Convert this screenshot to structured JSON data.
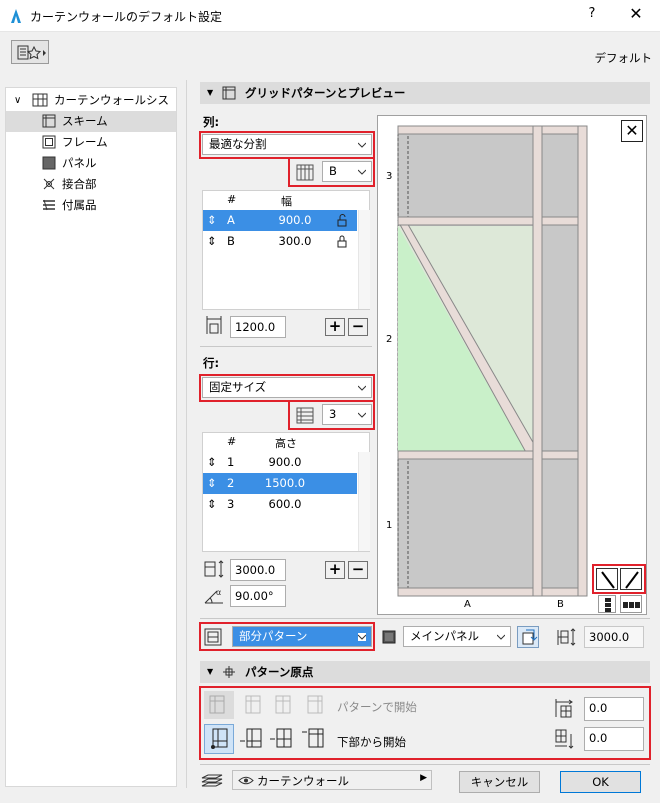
{
  "window": {
    "title": "カーテンウォールのデフォルト設定",
    "help": "?",
    "close": "✕"
  },
  "header": {
    "default_label": "デフォルト"
  },
  "tree": {
    "root": "カーテンウォールシステム",
    "items": [
      {
        "label": "スキーム",
        "selected": true
      },
      {
        "label": "フレーム",
        "selected": false
      },
      {
        "label": "パネル",
        "selected": false
      },
      {
        "label": "接合部",
        "selected": false
      },
      {
        "label": "付属品",
        "selected": false
      }
    ]
  },
  "grid_section": {
    "title": "グリッドパターンとプレビュー",
    "columns": {
      "label": "列:",
      "mode": "最適な分割",
      "pattern_select": "B",
      "headers": [
        "#",
        "幅"
      ],
      "rows": [
        {
          "sort": "⇕",
          "id": "A",
          "value": "900.0",
          "lock": "unlocked",
          "selected": true
        },
        {
          "sort": "⇕",
          "id": "B",
          "value": "300.0",
          "lock": "locked",
          "selected": false
        }
      ],
      "total": "1200.0"
    },
    "rows_part": {
      "label": "行:",
      "mode": "固定サイズ",
      "pattern_select": "3",
      "headers": [
        "#",
        "高さ"
      ],
      "rows": [
        {
          "sort": "⇕",
          "id": "1",
          "value": "900.0",
          "selected": false
        },
        {
          "sort": "⇕",
          "id": "2",
          "value": "1500.0",
          "selected": true
        },
        {
          "sort": "⇕",
          "id": "3",
          "value": "600.0",
          "selected": false
        }
      ],
      "total": "3000.0",
      "angle": "90.00°"
    },
    "preview": {
      "row_labels": [
        "3",
        "2",
        "1"
      ],
      "col_labels": [
        "A",
        "B"
      ],
      "close": "✕"
    },
    "bottom": {
      "pattern_mode": "部分パターン",
      "panel_type": "メインパネル",
      "height": "3000.0"
    }
  },
  "origin_section": {
    "title": "パターン原点",
    "start_top_label": "パターンで開始",
    "start_bottom_label": "下部から開始",
    "offset_x": "0.0",
    "offset_y": "0.0"
  },
  "footer": {
    "layer": "カーテンウォール",
    "cancel": "キャンセル",
    "ok": "OK"
  },
  "colors": {
    "selection": "#3b8fe5",
    "highlight_border": "#e0212b",
    "panel_green": "#c9f0c9"
  }
}
